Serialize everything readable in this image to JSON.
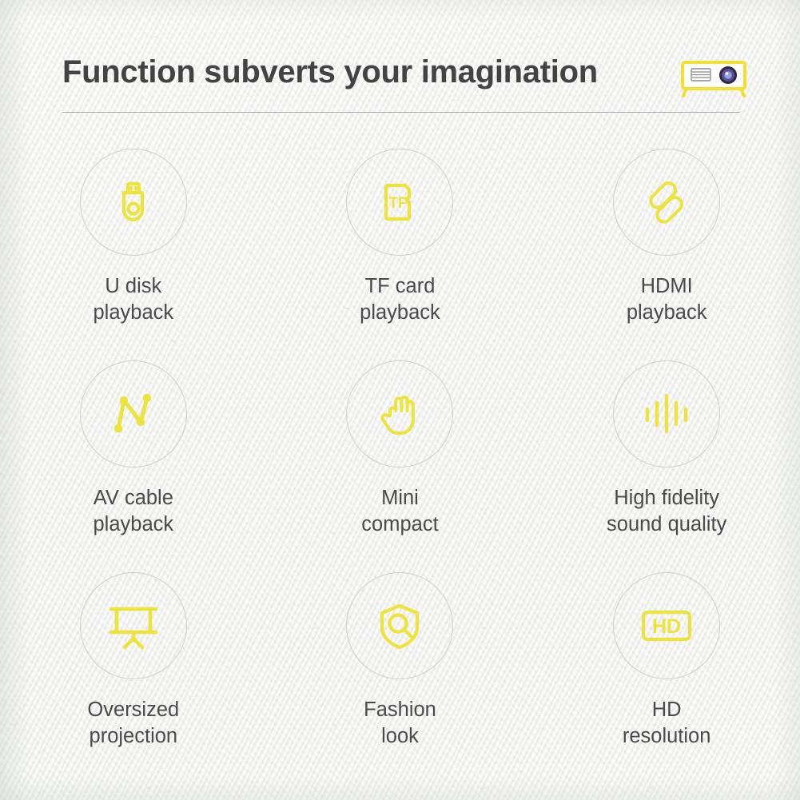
{
  "header": {
    "title": "Function subverts your imagination",
    "projector_icon": "projector-icon"
  },
  "colors": {
    "accent_yellow": "#ece33c",
    "text_dark": "#434343",
    "label_gray": "#4a4a4a",
    "circle_outline": "#cdd0cd",
    "divider": "#9aa0a2",
    "background": "#f3f4f2"
  },
  "features": [
    {
      "icon": "usb-flash-drive-icon",
      "label": "U disk\nplayback"
    },
    {
      "icon": "tf-card-icon",
      "label": "TF card\nplayback",
      "icon_text": "TF"
    },
    {
      "icon": "hdmi-cable-icon",
      "label": "HDMI\nplayback"
    },
    {
      "icon": "av-cable-node-icon",
      "label": "AV cable\nplayback"
    },
    {
      "icon": "hand-palm-icon",
      "label": "Mini\ncompact"
    },
    {
      "icon": "sound-wave-icon",
      "label": "High fidelity\nsound quality"
    },
    {
      "icon": "projection-screen-icon",
      "label": "Oversized\nprojection"
    },
    {
      "icon": "shield-search-icon",
      "label": "Fashion\nlook"
    },
    {
      "icon": "hd-badge-icon",
      "label": "HD\nresolution",
      "icon_text": "HD"
    }
  ]
}
